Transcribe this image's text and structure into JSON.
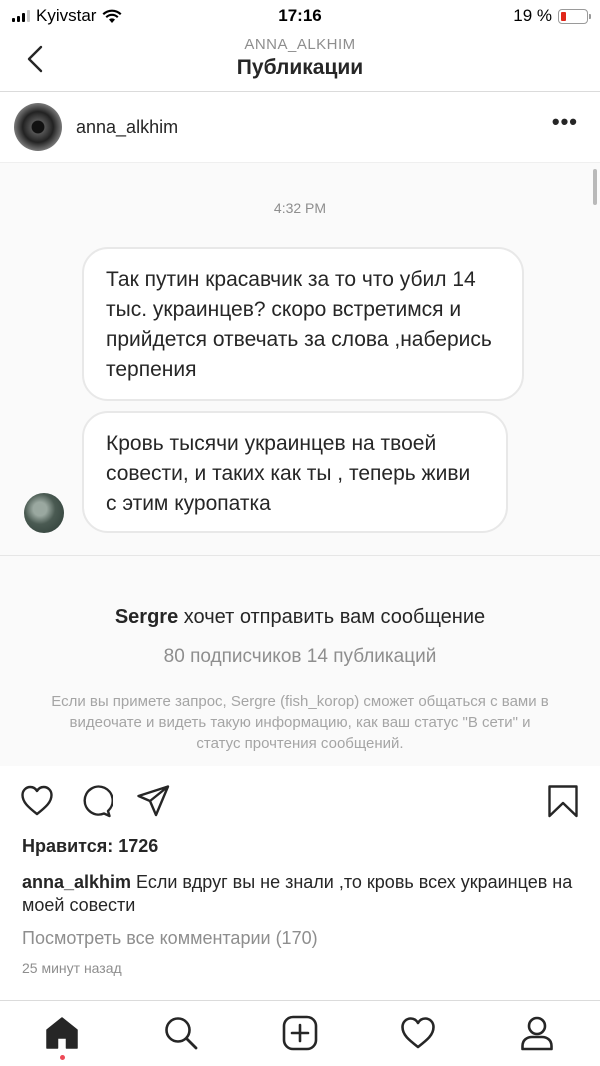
{
  "status_bar": {
    "carrier": "Kyivstar",
    "time": "17:16",
    "battery": "19 %",
    "battery_level": 0.19,
    "battery_color": "#e0271a"
  },
  "nav": {
    "subtitle": "ANNA_ALKHIM",
    "title": "Публикации",
    "back_icon": "chevron-left-icon"
  },
  "post": {
    "username": "anna_alkhim",
    "more_label": "•••",
    "dm": {
      "timestamp": "4:32 PM",
      "messages": [
        "Так путин красавчик за то что убил 14 тыс. украинцев? скоро встретимся и прийдется отвечать за слова ,наберись терпения",
        "Кровь тысячи украинцев на твоей совести, и таких как ты , теперь живи с этим куропатка"
      ],
      "request": {
        "sender": "Sergre",
        "title_rest": "хочет отправить вам сообщение",
        "stats": "80 подписчиков 14 публикаций",
        "info": "Если вы примете запрос, Sergre (fish_korop) сможет общаться с вами в видеочате и видеть такую информацию, как ваш статус \"В сети\" и статус прочтения сообщений."
      }
    },
    "likes": "Нравится: 1726",
    "caption_user": "anna_alkhim",
    "caption_text": " Если вдруг вы не знали ,то кровь всех украинцев на моей совести",
    "view_comments": "Посмотреть все комментарии (170)",
    "time_ago": "25 минут назад"
  },
  "actions": [
    "heart-icon",
    "comment-icon",
    "share-icon",
    "bookmark-icon"
  ],
  "tabbar": [
    "home-icon",
    "search-icon",
    "add-post-icon",
    "activity-icon",
    "profile-icon"
  ],
  "colors": {
    "text": "#262626",
    "secondary": "#8e8e8e",
    "notification_dot": "#ed4956"
  }
}
